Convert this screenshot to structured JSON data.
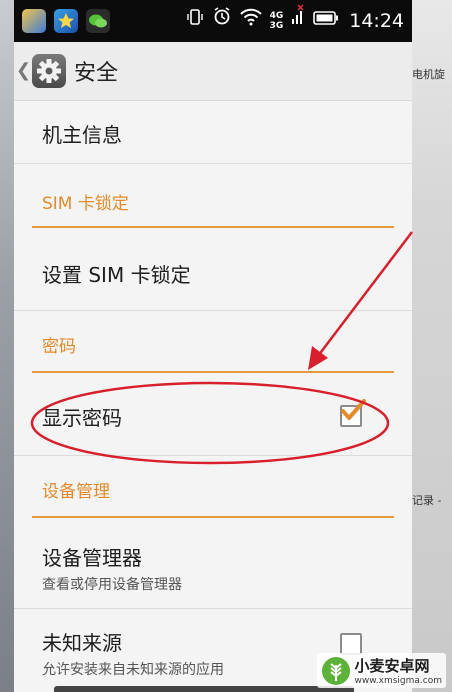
{
  "status_bar": {
    "net_top": "4G",
    "net_bottom": "3G",
    "time": "14:24",
    "icons": [
      "vibrate-icon",
      "alarm-icon",
      "wifi-icon",
      "signal-icon",
      "battery-icon"
    ]
  },
  "header": {
    "title": "安全",
    "icon": "settings-gear-icon"
  },
  "list": {
    "owner_info": "机主信息",
    "sim_lock_section": "SIM 卡锁定",
    "sim_lock_setting": "设置 SIM 卡锁定",
    "password_section": "密码",
    "show_password": "显示密码",
    "show_password_checked": true,
    "device_admin_section": "设备管理",
    "device_admin": {
      "title": "设备管理器",
      "subtitle": "查看或停用设备管理器"
    },
    "unknown_sources": {
      "title": "未知来源",
      "subtitle": "允许安装来自未知来源的应用"
    }
  },
  "background": {
    "right_texts": [
      "电机旋",
      "记录 -"
    ]
  },
  "watermark": {
    "name": "小麦安卓网",
    "url": "www.xmsigma.com"
  },
  "colors": {
    "accent": "#e48a2a",
    "annotation": "#d81f2c"
  }
}
